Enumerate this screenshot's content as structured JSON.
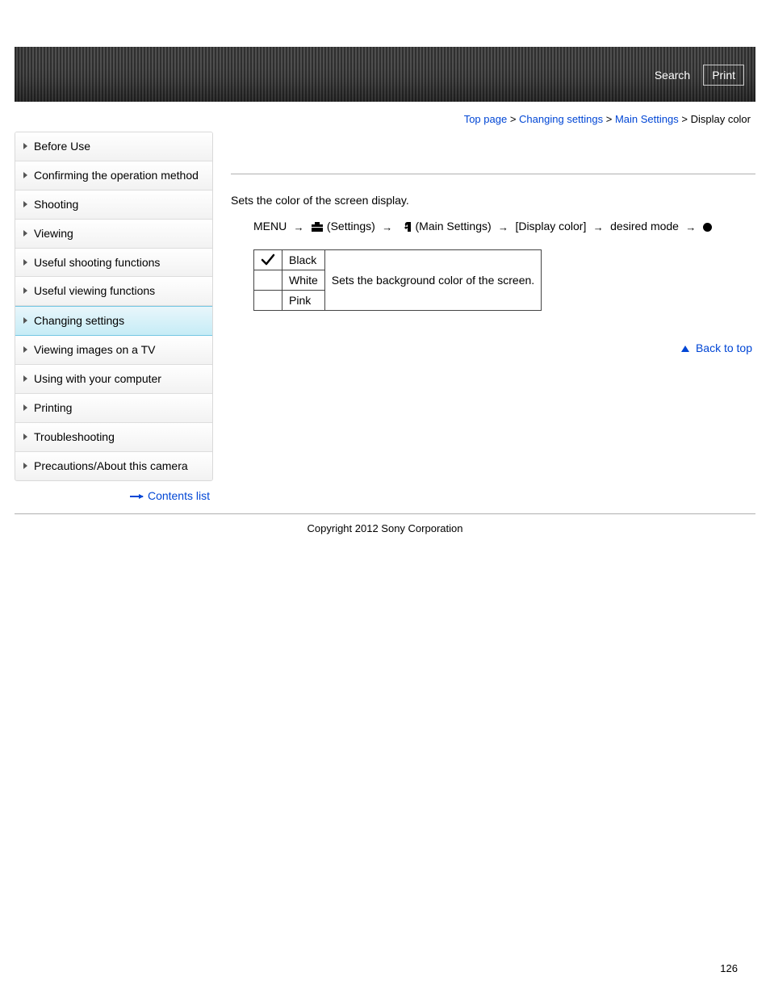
{
  "header": {
    "search_label": "Search",
    "print_label": "Print"
  },
  "breadcrumb": {
    "items": [
      {
        "label": "Top page"
      },
      {
        "label": "Changing settings"
      },
      {
        "label": "Main Settings"
      }
    ],
    "current": "Display color"
  },
  "sidebar": {
    "items": [
      {
        "label": "Before Use",
        "active": false
      },
      {
        "label": "Confirming the operation method",
        "active": false
      },
      {
        "label": "Shooting",
        "active": false
      },
      {
        "label": "Viewing",
        "active": false
      },
      {
        "label": "Useful shooting functions",
        "active": false
      },
      {
        "label": "Useful viewing functions",
        "active": false
      },
      {
        "label": "Changing settings",
        "active": true
      },
      {
        "label": "Viewing images on a TV",
        "active": false
      },
      {
        "label": "Using with your computer",
        "active": false
      },
      {
        "label": "Printing",
        "active": false
      },
      {
        "label": "Troubleshooting",
        "active": false
      },
      {
        "label": "Precautions/About this camera",
        "active": false
      }
    ],
    "contents_list_label": "Contents list"
  },
  "main": {
    "intro": "Sets the color of the screen display.",
    "menupath": {
      "menu_label": "MENU",
      "settings_label": "(Settings)",
      "main_settings_label": "(Main Settings)",
      "display_color_label": "[Display color]",
      "desired_mode_label": "desired mode"
    },
    "options_table": {
      "description": "Sets the background color of the screen.",
      "rows": [
        {
          "name": "Black",
          "checked": true
        },
        {
          "name": "White",
          "checked": false
        },
        {
          "name": "Pink",
          "checked": false
        }
      ]
    },
    "back_to_top_label": "Back to top"
  },
  "footer": {
    "copyright": "Copyright 2012 Sony Corporation",
    "page_number": "126"
  }
}
